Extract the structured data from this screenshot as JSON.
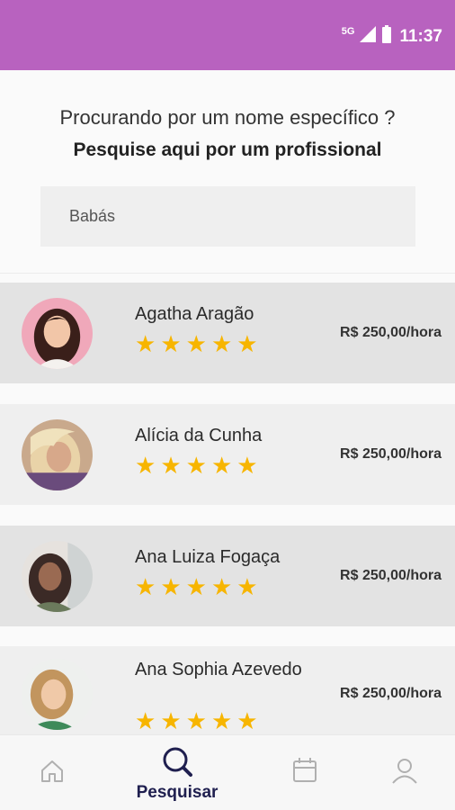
{
  "status_bar": {
    "network": "5G",
    "time": "11:37",
    "color": "#b862bf"
  },
  "search": {
    "title": "Procurando por um nome específico ?",
    "subtitle": "Pesquise aqui por um profissional",
    "input_value": "Babás"
  },
  "professionals": [
    {
      "name": "Agatha Aragão",
      "rating": 5,
      "price": "R$ 250,00/hora"
    },
    {
      "name": "Alícia da Cunha",
      "rating": 5,
      "price": "R$ 250,00/hora"
    },
    {
      "name": "Ana Luiza Fogaça",
      "rating": 5,
      "price": "R$ 250,00/hora"
    },
    {
      "name": "Ana Sophia Azevedo",
      "rating": 5,
      "price": "R$ 250,00/hora"
    }
  ],
  "bottom_nav": {
    "items": [
      {
        "icon": "home-icon",
        "label": ""
      },
      {
        "icon": "search-icon",
        "label": "Pesquisar",
        "active": true
      },
      {
        "icon": "calendar-icon",
        "label": ""
      },
      {
        "icon": "profile-icon",
        "label": ""
      }
    ]
  },
  "colors": {
    "accent": "#b862bf",
    "star": "#f7b500",
    "nav_active": "#1f1f4f"
  }
}
